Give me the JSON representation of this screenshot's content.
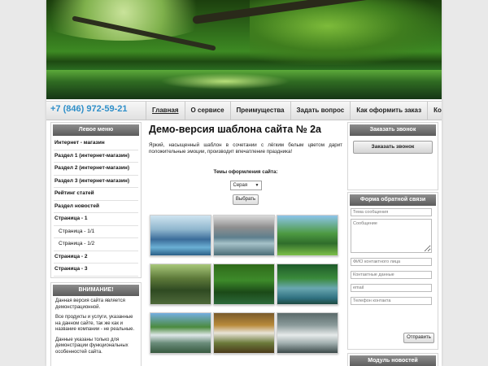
{
  "header": {
    "phone": "+7 (846) 972-59-21"
  },
  "menu": [
    {
      "label": "Главная",
      "active": true
    },
    {
      "label": "О сервисе",
      "active": false
    },
    {
      "label": "Преимущества",
      "active": false
    },
    {
      "label": "Задать вопрос",
      "active": false
    },
    {
      "label": "Как оформить заказ",
      "active": false
    },
    {
      "label": "Контакты",
      "active": false
    }
  ],
  "left_menu": {
    "title": "Левое меню",
    "items": [
      {
        "label": "Интернет - магазин",
        "sub": false
      },
      {
        "label": "Раздел 1 (интернет-магазин)",
        "sub": false
      },
      {
        "label": "Раздел 2 (интернет-магазин)",
        "sub": false
      },
      {
        "label": "Раздел 3 (интернет-магазин)",
        "sub": false
      },
      {
        "label": "Рейтинг статей",
        "sub": false
      },
      {
        "label": "Раздел новостей",
        "sub": false
      },
      {
        "label": "Страница - 1",
        "sub": false
      },
      {
        "label": "Страница - 1/1",
        "sub": true
      },
      {
        "label": "Страница - 1/2",
        "sub": true
      },
      {
        "label": "Страница - 2",
        "sub": false
      },
      {
        "label": "Страница - 3",
        "sub": false
      }
    ]
  },
  "notice": {
    "title": "ВНИМАНИЕ!",
    "p1": "Данная версия сайта является демонстрационной.",
    "p2": "Все продукты и услуги, указанные на данном сайте, так же как и название компании - не реальные.",
    "p3": "Данные указаны только для демонстрации функциональных особенностей сайта."
  },
  "main": {
    "title": "Демо-версия шаблона сайта № 2а",
    "intro": "Яркий, насыщенный шаблон в сочетании с лёгким белым цветом дарит положительные эмоции, производит впечатление праздника!",
    "theme_label": "Темы оформления сайта:",
    "theme_value": "Серая",
    "select_button": "Выбрать"
  },
  "gallery": [
    "photo-1",
    "photo-2",
    "photo-3",
    "photo-4",
    "photo-5",
    "photo-6",
    "photo-7",
    "photo-8",
    "photo-9"
  ],
  "order_call": {
    "title": "Заказать звонок",
    "button": "Заказать звонок"
  },
  "feedback": {
    "title": "Форма обратной связи",
    "subject_placeholder": "Тема сообщения",
    "message_placeholder": "Сообщение",
    "name_placeholder": "ФИО контактного лица",
    "contact_placeholder": "Контактные данные",
    "email_placeholder": "email",
    "phone_placeholder": "Телефон контакта",
    "send_button": "Отправить"
  },
  "news": {
    "title": "Модуль новостей"
  }
}
